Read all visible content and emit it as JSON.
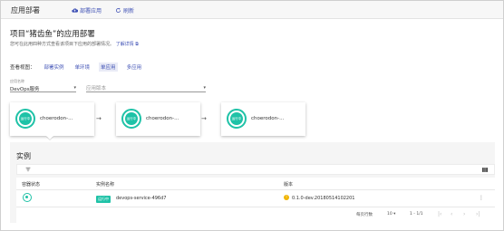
{
  "header": {
    "title": "应用部署",
    "deploy_label": "部署应用",
    "refresh_label": "刷新"
  },
  "page": {
    "title": "项目“猪齿鱼”的应用部署",
    "description": "您可在此用四种方式查看该项目下应用的部署情况。",
    "learn_more": "了解详情"
  },
  "view": {
    "label": "查看视图：",
    "tabs": [
      {
        "label": "部署实例",
        "active": false
      },
      {
        "label": "单环境",
        "active": false
      },
      {
        "label": "单应用",
        "active": true
      },
      {
        "label": "多应用",
        "active": false
      }
    ]
  },
  "filters": {
    "app_label": "应用名称",
    "app_value": "DevOps服务",
    "version_placeholder": "应用版本"
  },
  "pipeline": {
    "stages": [
      {
        "status": "运行中",
        "name": "choerodon-..."
      },
      {
        "status": "运行中",
        "name": "choerodon-..."
      },
      {
        "status": "运行中",
        "name": "choerodon-..."
      }
    ],
    "arrow": "→"
  },
  "instances": {
    "title": "实例",
    "columns": [
      "容器状态",
      "实例名称",
      "版本"
    ],
    "rows": [
      {
        "status_badge": "运行中",
        "name": "devops-service-496d7",
        "version": "0.1.0-dev.20180514102201"
      }
    ],
    "pagination": {
      "rows_label": "每页行数",
      "page_size": "10",
      "range": "1 - 1/1"
    }
  },
  "colors": {
    "accent": "#3f51b5",
    "running": "#1fc2a7",
    "version_icon": "#f0b400"
  }
}
